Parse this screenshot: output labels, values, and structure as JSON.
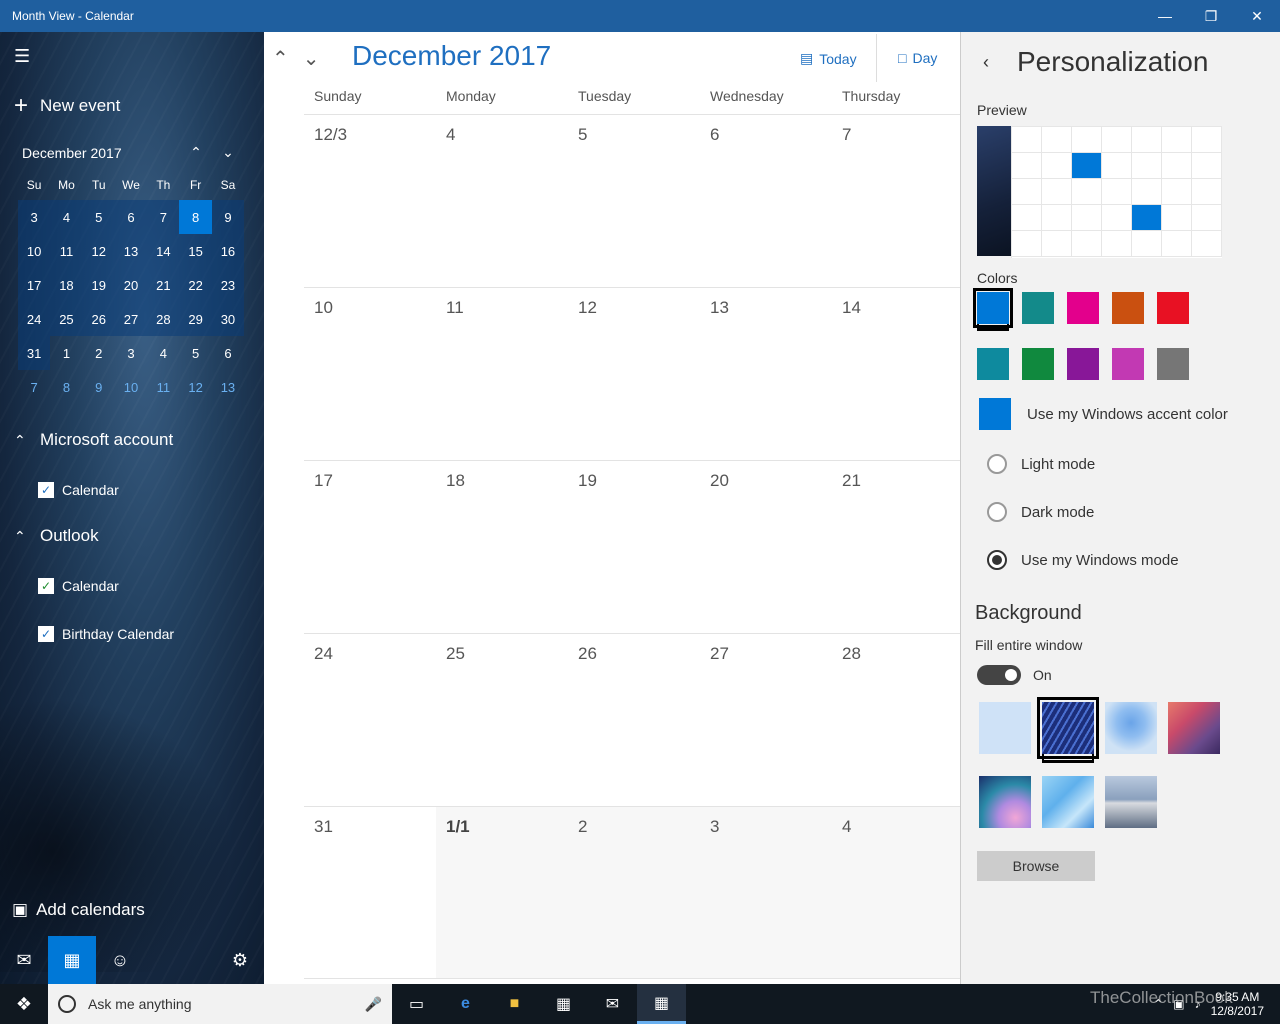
{
  "window": {
    "title": "Month View - Calendar"
  },
  "sidebar": {
    "new_event": "New event",
    "mini_month": "December 2017",
    "dow": [
      "Su",
      "Mo",
      "Tu",
      "We",
      "Th",
      "Fr",
      "Sa"
    ],
    "weeks": [
      [
        "3",
        "4",
        "5",
        "6",
        "7",
        "8",
        "9"
      ],
      [
        "10",
        "11",
        "12",
        "13",
        "14",
        "15",
        "16"
      ],
      [
        "17",
        "18",
        "19",
        "20",
        "21",
        "22",
        "23"
      ],
      [
        "24",
        "25",
        "26",
        "27",
        "28",
        "29",
        "30"
      ],
      [
        "31",
        "1",
        "2",
        "3",
        "4",
        "5",
        "6"
      ],
      [
        "7",
        "8",
        "9",
        "10",
        "11",
        "12",
        "13"
      ]
    ],
    "selected_day": "8",
    "accounts": [
      {
        "name": "Microsoft account",
        "calendars": [
          "Calendar"
        ]
      },
      {
        "name": "Outlook",
        "calendars": [
          "Calendar",
          "Birthday Calendar"
        ]
      }
    ],
    "add_calendars": "Add calendars",
    "icons": {
      "mail": "mail-icon",
      "calendar": "calendar-icon",
      "people": "people-icon",
      "settings": "gear-icon"
    }
  },
  "main": {
    "month_title": "December 2017",
    "today_label": "Today",
    "day_label": "Day",
    "dow": [
      "Sunday",
      "Monday",
      "Tuesday",
      "Wednesday",
      "Thursday"
    ],
    "rows": [
      [
        "12/3",
        "4",
        "5",
        "6",
        "7"
      ],
      [
        "10",
        "11",
        "12",
        "13",
        "14"
      ],
      [
        "17",
        "18",
        "19",
        "20",
        "21"
      ],
      [
        "24",
        "25",
        "26",
        "27",
        "28"
      ],
      [
        "31",
        "1/1",
        "2",
        "3",
        "4"
      ]
    ]
  },
  "pane": {
    "title": "Personalization",
    "preview_label": "Preview",
    "colors_label": "Colors",
    "colors_row1": [
      "#0078d7",
      "#138a8a",
      "#e3008c",
      "#ca5010",
      "#e81123"
    ],
    "colors_row2": [
      "#0e8a9e",
      "#10893e",
      "#881798",
      "#c239b3",
      "#767676"
    ],
    "accent_label": "Use my Windows accent color",
    "modes": [
      "Light mode",
      "Dark mode",
      "Use my Windows mode"
    ],
    "selected_mode": "Use my Windows mode",
    "background_title": "Background",
    "fill_label": "Fill entire window",
    "toggle_state": "On",
    "browse_label": "Browse"
  },
  "taskbar": {
    "search_placeholder": "Ask me anything",
    "time": "9:35 AM",
    "date": "12/8/2017",
    "watermark": "TheCollectionBook"
  }
}
